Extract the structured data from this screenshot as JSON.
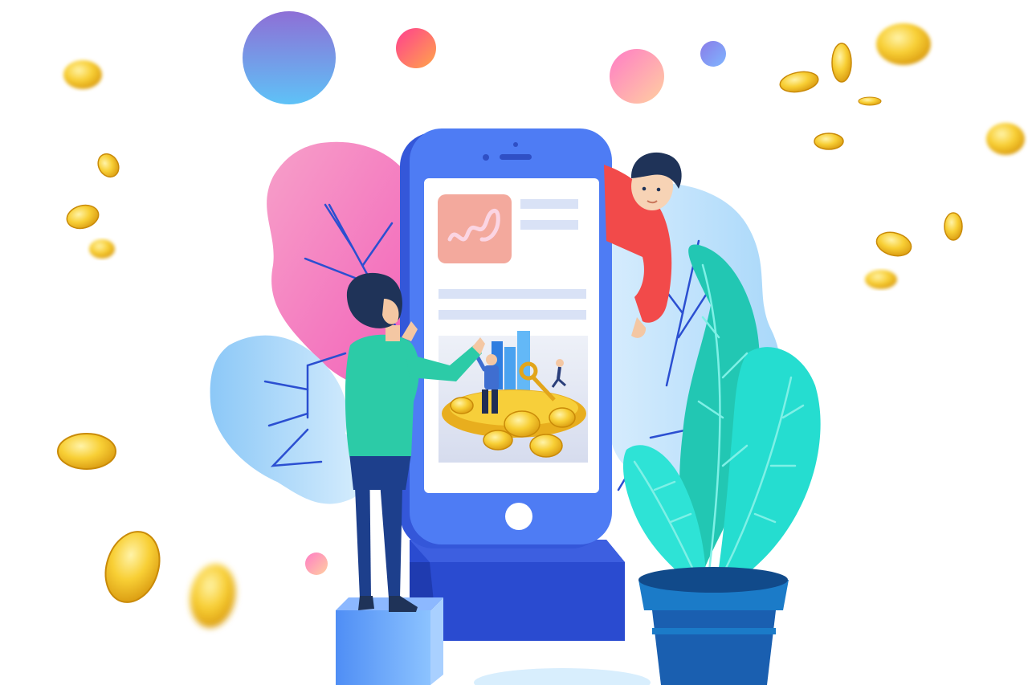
{
  "scene": {
    "description_visible_text": [],
    "palette": {
      "background": "#ffffff",
      "phone_body": "#4f7bf3",
      "phone_dark": "#3556d8",
      "phone_screen": "#ffffff",
      "screen_bars": "#d9e2f6",
      "app_icon": "#f3a99d",
      "stand": "#2f4fd0",
      "plant_leaf": "#22d3c5",
      "pot": "#1e5fb0",
      "coin": "#f5c431",
      "man_shirt": "#2ccba7",
      "man_pants": "#1d3f8c",
      "woman_shirt": "#f24a4a",
      "hair": "#1f3358",
      "blob_pink": "#f46fc0",
      "blob_blue": "#9fd2f8"
    },
    "icons": {
      "app_logo": "wave-logo-icon",
      "home_button": "home-button-icon"
    }
  }
}
